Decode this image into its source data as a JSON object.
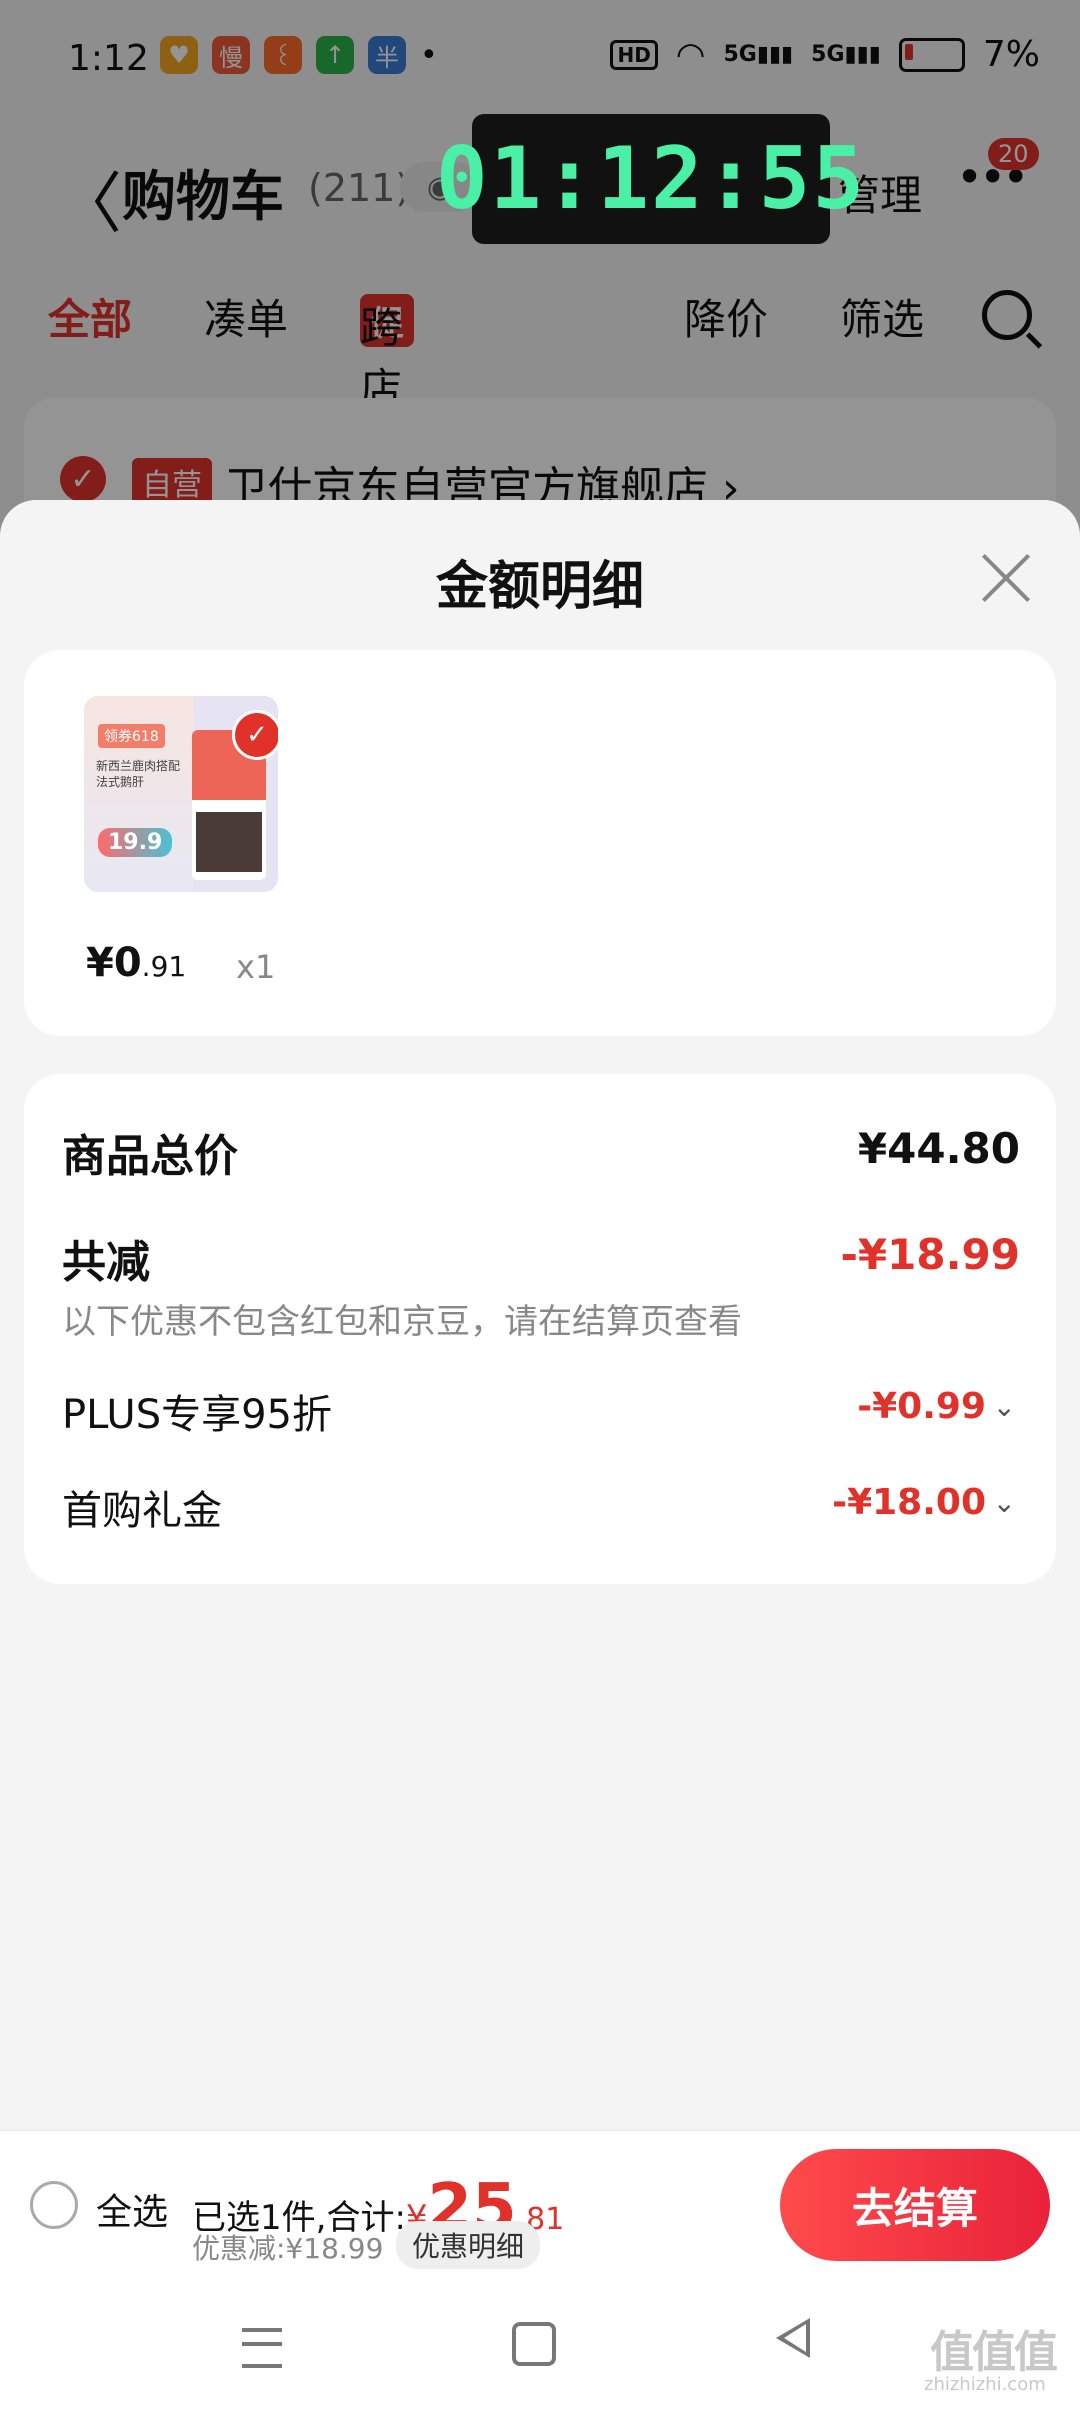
{
  "status_bar": {
    "time": "1:12",
    "app_icons": [
      {
        "name": "app-icon-heart",
        "glyph": "♥",
        "color": "#f5a623"
      },
      {
        "name": "app-icon-man",
        "glyph": "慢",
        "color": "#f05a3c"
      },
      {
        "name": "app-icon-taobao",
        "glyph": "꒰",
        "color": "#ff6a2b"
      },
      {
        "name": "app-icon-up",
        "glyph": "↑",
        "color": "#2cb34a"
      },
      {
        "name": "app-icon-badge",
        "glyph": "半",
        "color": "#3a7bd5"
      }
    ],
    "dot": "•",
    "hd": "HD",
    "signal1": "5G",
    "signal2": "5G",
    "battery": "7%"
  },
  "header": {
    "back": "〈",
    "title": "购物车",
    "count": "(211)",
    "eye": "◉",
    "manage": "管理",
    "more": "•••",
    "more_badge": "20"
  },
  "timer": "01:12:55",
  "filters": {
    "all": "全部",
    "combine": "凑单",
    "promo_badge": "促",
    "cross_store": "跨店满减",
    "price_drop": "降价",
    "filter": "筛选"
  },
  "store": {
    "tag": "自营",
    "name": "卫仕京东自营官方旗舰店 ›"
  },
  "sheet": {
    "title": "金额明细",
    "product": {
      "unit_price_int": "¥0",
      "unit_price_dec": ".91",
      "qty": "x1",
      "image_tag": "领券618",
      "image_text": "新西兰鹿肉搭配法式鹅肝",
      "image_price": "19.9"
    },
    "details": {
      "total_label": "商品总价",
      "total_value": "¥44.80",
      "reduce_label": "共减",
      "reduce_value": "-¥18.99",
      "note": "以下优惠不包含红包和京豆，请在结算页查看",
      "plus_label": "PLUS专享95折",
      "plus_value": "-¥0.99",
      "gift_label": "首购礼金",
      "gift_value": "-¥18.00",
      "chevron": "⌄"
    }
  },
  "checkout": {
    "select_all": "全选",
    "summary_prefix": "已选1件,合计:",
    "yen": "¥",
    "amount_int": "25",
    "amount_dec": ".81",
    "discount": "优惠减:¥18.99",
    "discount_detail": "优惠明细",
    "button": "去结算"
  },
  "watermark": {
    "main": "值值值",
    "sub": "zhizhizhi.com"
  }
}
